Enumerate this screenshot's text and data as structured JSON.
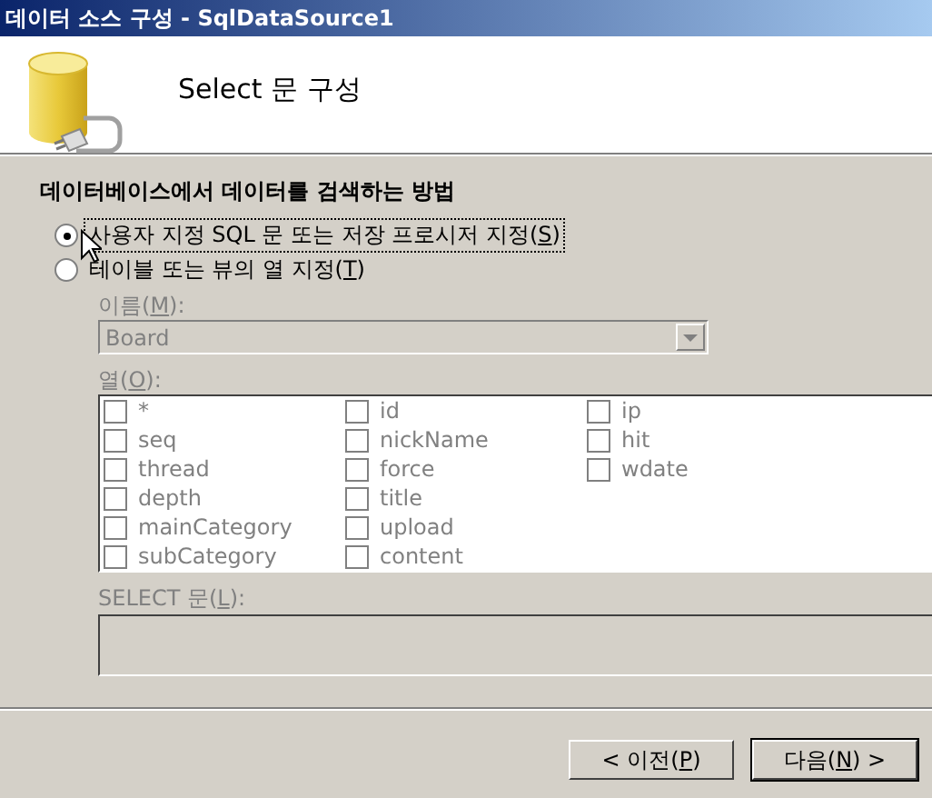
{
  "window": {
    "title": "데이터 소스 구성 - SqlDataSource1"
  },
  "header": {
    "title": "Select 문 구성"
  },
  "section": {
    "heading": "데이터베이스에서 데이터를 검색하는 방법"
  },
  "options": [
    {
      "label": "사용자 지정 SQL 문 또는 저장 프로시저 지정(S)",
      "selected": true,
      "focused": true
    },
    {
      "label": "테이블 또는 뷰의 열 지정(T)",
      "selected": false,
      "focused": false
    }
  ],
  "table_group": {
    "disabled": true,
    "name_label": "이름(M):",
    "name_value": "Board",
    "columns_label": "열(O):",
    "columns": [
      {
        "label": "*",
        "checked": false
      },
      {
        "label": "seq",
        "checked": false
      },
      {
        "label": "thread",
        "checked": false
      },
      {
        "label": "depth",
        "checked": false
      },
      {
        "label": "mainCategory",
        "checked": false
      },
      {
        "label": "subCategory",
        "checked": false
      },
      {
        "label": "id",
        "checked": false
      },
      {
        "label": "nickName",
        "checked": false
      },
      {
        "label": "force",
        "checked": false
      },
      {
        "label": "title",
        "checked": false
      },
      {
        "label": "upload",
        "checked": false
      },
      {
        "label": "content",
        "checked": false
      },
      {
        "label": "ip",
        "checked": false
      },
      {
        "label": "hit",
        "checked": false
      },
      {
        "label": "wdate",
        "checked": false
      }
    ],
    "select_label": "SELECT 문(L):"
  },
  "buttons": [
    {
      "label": "< 이전(P)",
      "default": false
    },
    {
      "label": "다음(N) >",
      "default": true
    }
  ]
}
